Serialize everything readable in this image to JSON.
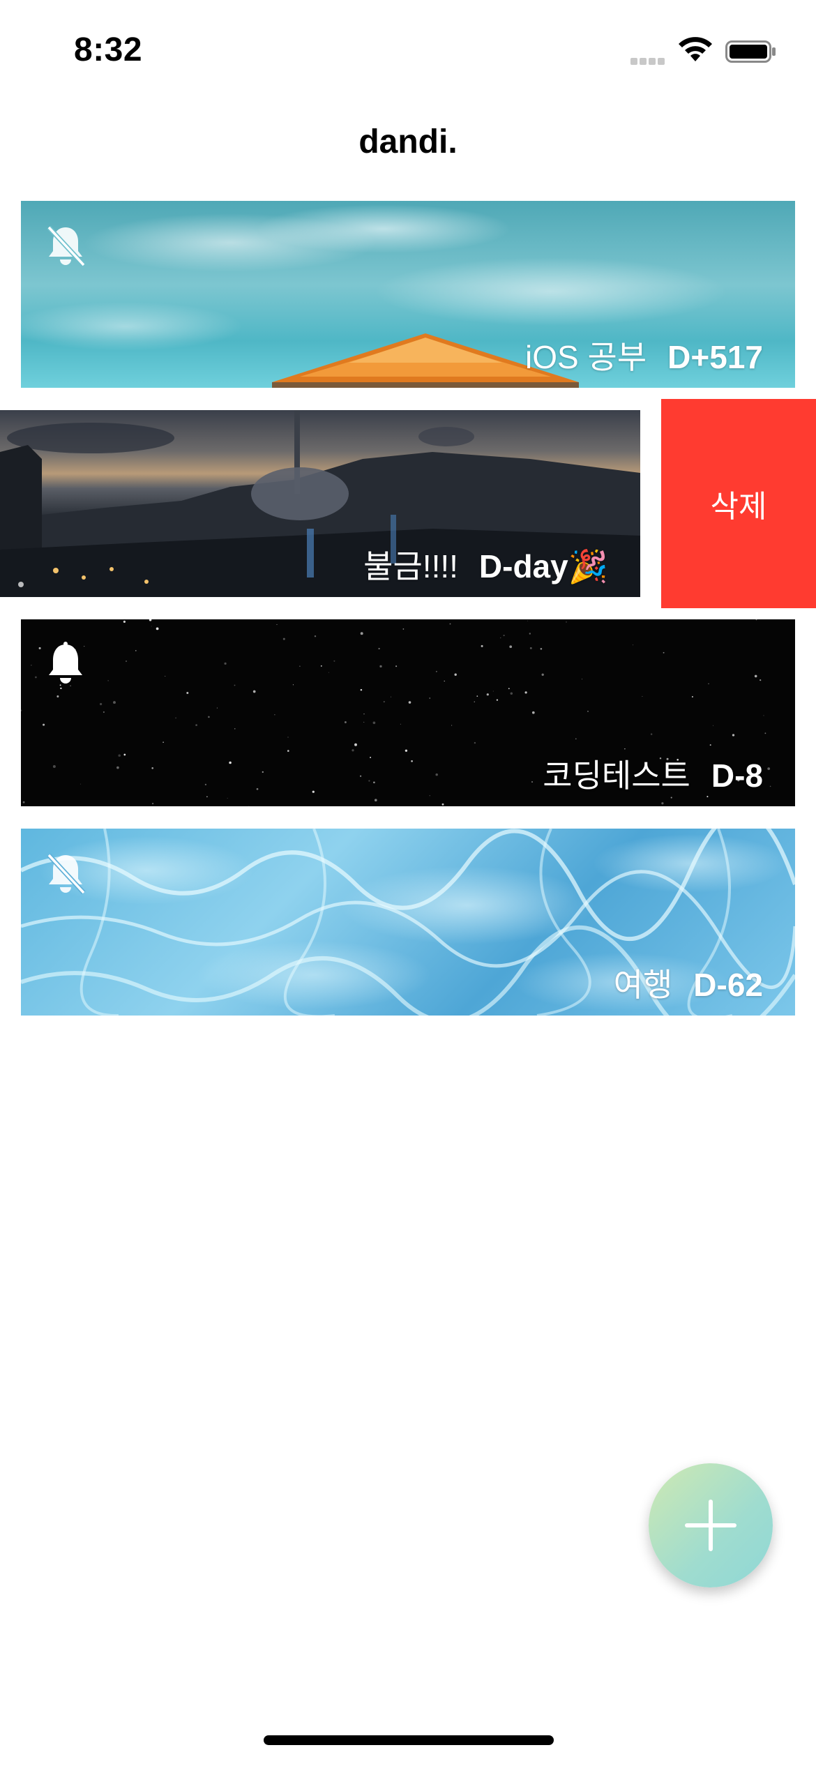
{
  "status_bar": {
    "time": "8:32"
  },
  "header": {
    "title": "dandi."
  },
  "cards": [
    {
      "name": "iOS 공부",
      "dday": "D+517",
      "alarm": "off",
      "background": "sky"
    },
    {
      "name": "불금!!!!",
      "dday": "D-day🎉",
      "alarm": "none-visible",
      "background": "city-night"
    },
    {
      "name": "코딩테스트",
      "dday": "D-8",
      "alarm": "on",
      "background": "starfield"
    },
    {
      "name": "여행",
      "dday": "D-62",
      "alarm": "off",
      "background": "water"
    }
  ],
  "swipe_action": {
    "label": "삭제",
    "color": "#ff3b30"
  },
  "fab": {
    "icon": "plus-icon",
    "gradient": [
      "#cfe9b2",
      "#8fd7d6"
    ]
  }
}
